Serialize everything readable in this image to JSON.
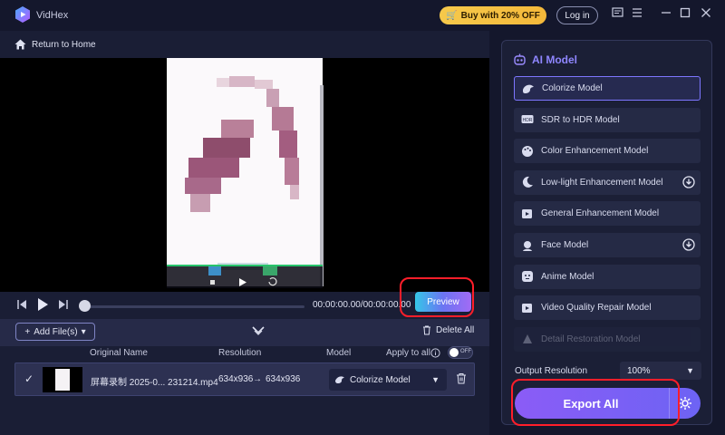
{
  "app": {
    "name": "VidHex",
    "buy_label": "Buy with 20% OFF",
    "login_label": "Log in"
  },
  "nav": {
    "back_label": "Return to Home"
  },
  "player": {
    "timecode": "00:00:00.00/00:00:00.00",
    "preview_label": "Preview",
    "progress": 0.0
  },
  "files": {
    "add_label": "Add File(s)",
    "delete_all_label": "Delete All",
    "columns": {
      "name": "Original Name",
      "resolution": "Resolution",
      "model": "Model",
      "apply_all": "Apply to all"
    },
    "apply_toggle": "OFF",
    "rows": [
      {
        "name": "屏幕录制 2025-0... 231214.mp4",
        "resolution_from": "634x936",
        "arrow": "→",
        "resolution_to": "634x936",
        "model": "Colorize Model"
      }
    ]
  },
  "ai_panel": {
    "title": "AI Model",
    "models": [
      {
        "label": "Colorize Model",
        "icon": "palette-brush-icon",
        "selected": true
      },
      {
        "label": "SDR to HDR Model",
        "icon": "hdr-icon"
      },
      {
        "label": "Color Enhancement Model",
        "icon": "palette-icon"
      },
      {
        "label": "Low-light Enhancement Model",
        "icon": "moon-icon",
        "download": true
      },
      {
        "label": "General Enhancement Model",
        "icon": "video-enhance-icon"
      },
      {
        "label": "Face Model",
        "icon": "face-icon",
        "download": true
      },
      {
        "label": "Anime Model",
        "icon": "anime-icon"
      },
      {
        "label": "Video Quality Repair Model",
        "icon": "video-repair-icon"
      },
      {
        "label": "Detail Restoration Model",
        "icon": "detail-icon",
        "faded": true
      }
    ],
    "output_resolution_label": "Output Resolution",
    "output_resolution_value": "100%",
    "export_label": "Export All"
  },
  "colors": {
    "accent": "#8b5cf6",
    "highlight": "#ff1e2a",
    "gold": "#f6c94b"
  }
}
